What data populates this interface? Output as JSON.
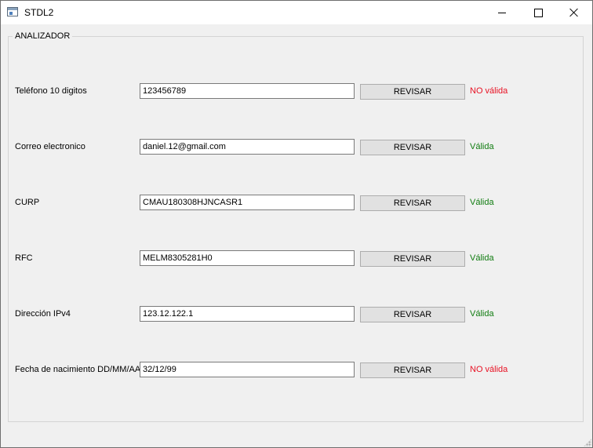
{
  "window": {
    "title": "STDL2",
    "icon": "app-window-icon"
  },
  "group": {
    "title": "ANALIZADOR"
  },
  "rows": [
    {
      "label": "Teléfono 10 digitos",
      "value": "123456789",
      "button": "REVISAR",
      "status": "NO válida",
      "valid": false
    },
    {
      "label": "Correo electronico",
      "value": "daniel.12@gmail.com",
      "button": "REVISAR",
      "status": "Válida",
      "valid": true
    },
    {
      "label": "CURP",
      "value": "CMAU180308HJNCASR1",
      "button": "REVISAR",
      "status": "Válida",
      "valid": true
    },
    {
      "label": "RFC",
      "value": "MELM8305281H0",
      "button": "REVISAR",
      "status": "Válida",
      "valid": true
    },
    {
      "label": "Dirección IPv4",
      "value": "123.12.122.1",
      "button": "REVISAR",
      "status": "Válida",
      "valid": true
    },
    {
      "label": "Fecha de nacimiento DD/MM/AA",
      "value": "32/12/99",
      "button": "REVISAR",
      "status": "NO válida",
      "valid": false
    }
  ],
  "colors": {
    "invalid": "#e81123",
    "valid": "#107c10"
  }
}
